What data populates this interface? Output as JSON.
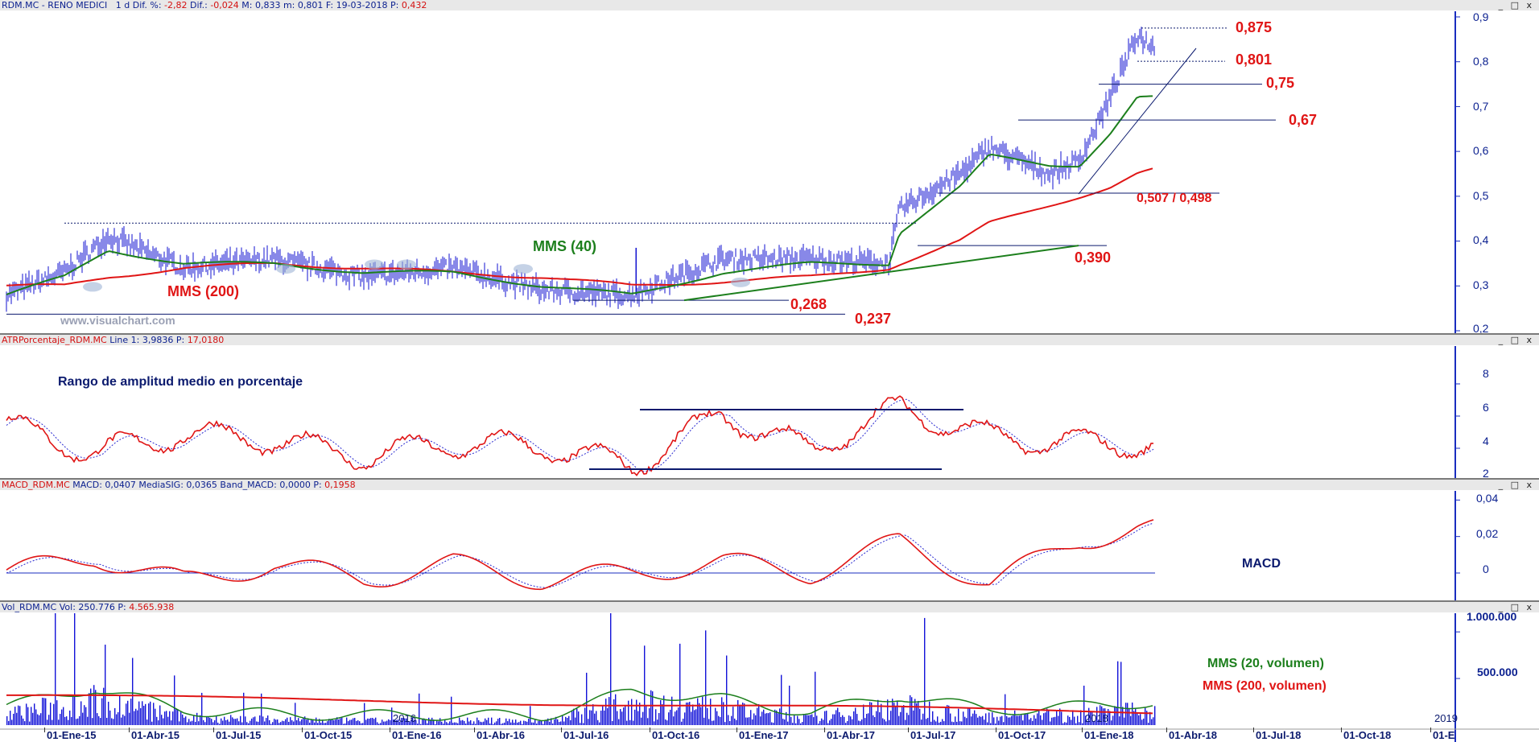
{
  "panels": {
    "price": {
      "header": {
        "symbol": "RDM.MC - RENO MEDICI",
        "period": "1 d",
        "dif_pct_label": "Dif. %:",
        "dif_pct": "-2,82",
        "dif_label": "Dif.:",
        "dif": "-0,024",
        "max": "M: 0,833",
        "min": "m: 0,801",
        "date": "F: 19-03-2018",
        "p_label": "P:",
        "p": "0,432"
      },
      "yticks": [
        "0,9",
        "0,8",
        "0,7",
        "0,6",
        "0,5",
        "0,4",
        "0,3",
        "0,2"
      ],
      "annotations": {
        "mms40": "MMS (40)",
        "mms200": "MMS (200)",
        "l0875": "0,875",
        "l0801": "0,801",
        "l075": "0,75",
        "l067": "0,67",
        "l0507": "0,507 / 0,498",
        "l0390": "0,390",
        "l0268": "0,268",
        "l0237": "0,237"
      },
      "watermark": "www.visualchart.com"
    },
    "atr": {
      "header": {
        "name": "ATRPorcentaje_RDM.MC",
        "line": "Line 1:",
        "line_val": "3,9836",
        "p_label": "P:",
        "p": "17,0180"
      },
      "title": "Rango de amplitud medio en porcentaje",
      "yticks": [
        "8",
        "6",
        "4",
        "2"
      ]
    },
    "macd": {
      "header": {
        "name": "MACD_RDM.MC",
        "macd": "MACD: 0,0407",
        "sig": "MediaSIG: 0,0365",
        "band": "Band_MACD: 0,0000",
        "p_label": "P:",
        "p": "0,1958"
      },
      "title": "MACD",
      "yticks": [
        "0,04",
        "0,02",
        "0"
      ]
    },
    "volume": {
      "header": {
        "name": "Vol_RDM.MC",
        "vol": "Vol: 250.776",
        "p_label": "P:",
        "p": "4.565.938"
      },
      "yticks": [
        "1.000.000",
        "500.000"
      ],
      "legend_green": "MMS (20, volumen)",
      "legend_red": "MMS (200, volumen)",
      "year_labels": [
        "2016",
        "2018",
        "2019"
      ]
    }
  },
  "window_buttons": "_ □ x",
  "x_axis": [
    "01-Ene-15",
    "01-Abr-15",
    "01-Jul-15",
    "01-Oct-15",
    "01-Ene-16",
    "01-Abr-16",
    "01-Jul-16",
    "01-Oct-16",
    "01-Ene-17",
    "01-Abr-17",
    "01-Jul-17",
    "01-Oct-17",
    "01-Ene-18",
    "01-Abr-18",
    "01-Jul-18",
    "01-Oct-18",
    "01-E"
  ],
  "colors": {
    "price": "#1010d0",
    "mms40": "#1c7f1c",
    "mms200": "#e01515",
    "axis": "#1a2dbf",
    "annotation": "#e01515"
  },
  "chart_data": [
    {
      "type": "line",
      "name": "price",
      "xlabel": "",
      "ylabel": "",
      "ylim": [
        0.2,
        0.9
      ],
      "x": [
        "2015-01-01",
        "2015-03-01",
        "2015-04-15",
        "2015-07-01",
        "2015-10-01",
        "2016-01-01",
        "2016-04-01",
        "2016-07-01",
        "2016-10-01",
        "2017-01-01",
        "2017-04-01",
        "2017-06-20",
        "2017-07-01",
        "2017-09-01",
        "2017-10-01",
        "2017-12-01",
        "2018-01-01",
        "2018-02-01",
        "2018-03-01",
        "2018-03-19"
      ],
      "series": [
        {
          "name": "",
          "values": [
            0.28,
            0.33,
            0.41,
            0.34,
            0.36,
            0.32,
            0.34,
            0.29,
            0.28,
            0.36,
            0.36,
            0.35,
            0.47,
            0.55,
            0.61,
            0.55,
            0.58,
            0.72,
            0.86,
            0.83
          ]
        },
        {
          "name": "MMS (40)",
          "values": [
            0.28,
            0.32,
            0.38,
            0.35,
            0.35,
            0.33,
            0.33,
            0.3,
            0.28,
            0.33,
            0.35,
            0.35,
            0.42,
            0.52,
            0.59,
            0.57,
            0.57,
            0.64,
            0.72,
            0.72
          ]
        },
        {
          "name": "MMS (200)",
          "values": [
            0.3,
            0.3,
            0.32,
            0.34,
            0.35,
            0.34,
            0.33,
            0.32,
            0.3,
            0.31,
            0.32,
            0.34,
            0.35,
            0.4,
            0.44,
            0.48,
            0.5,
            0.52,
            0.55,
            0.56
          ]
        }
      ],
      "levels": [
        0.875,
        0.801,
        0.75,
        0.67,
        0.507,
        0.498,
        0.39,
        0.268,
        0.237
      ]
    },
    {
      "type": "line",
      "name": "atr",
      "ylim": [
        2,
        10
      ],
      "x": [
        "2015-01",
        "2015-04",
        "2015-07",
        "2015-10",
        "2016-01",
        "2016-04",
        "2016-07",
        "2016-10",
        "2017-01",
        "2017-04",
        "2017-07",
        "2017-10",
        "2018-01",
        "2018-03"
      ],
      "series": [
        {
          "name": "",
          "values": [
            5.2,
            3.4,
            4.6,
            4.2,
            3.2,
            4.0,
            3.8,
            2.6,
            5.8,
            3.6,
            6.2,
            4.4,
            4.0,
            3.98
          ]
        }
      ]
    },
    {
      "type": "line",
      "name": "macd",
      "ylim": [
        -0.015,
        0.045
      ],
      "x": [
        "2015-01",
        "2015-04",
        "2015-07",
        "2015-10",
        "2016-01",
        "2016-04",
        "2016-07",
        "2016-10",
        "2017-01",
        "2017-04",
        "2017-07",
        "2017-10",
        "2018-01",
        "2018-03"
      ],
      "series": [
        {
          "name": "",
          "values": [
            0.0,
            0.015,
            -0.008,
            0.008,
            -0.006,
            0.008,
            -0.006,
            0.0,
            0.01,
            0.0,
            0.028,
            -0.01,
            0.03,
            0.0407
          ]
        }
      ]
    },
    {
      "type": "bar",
      "name": "volume",
      "ylim": [
        0,
        1200000
      ],
      "x": [
        "2015-01",
        "2015-04",
        "2015-07",
        "2015-10",
        "2016-01",
        "2016-04",
        "2016-07",
        "2016-10",
        "2017-01",
        "2017-04",
        "2017-07",
        "2017-10",
        "2018-01",
        "2018-03"
      ],
      "series": [
        {
          "name": "",
          "values": [
            200000,
            450000,
            150000,
            100000,
            80000,
            90000,
            70000,
            400000,
            300000,
            120000,
            350000,
            150000,
            200000,
            250776
          ]
        }
      ]
    }
  ]
}
